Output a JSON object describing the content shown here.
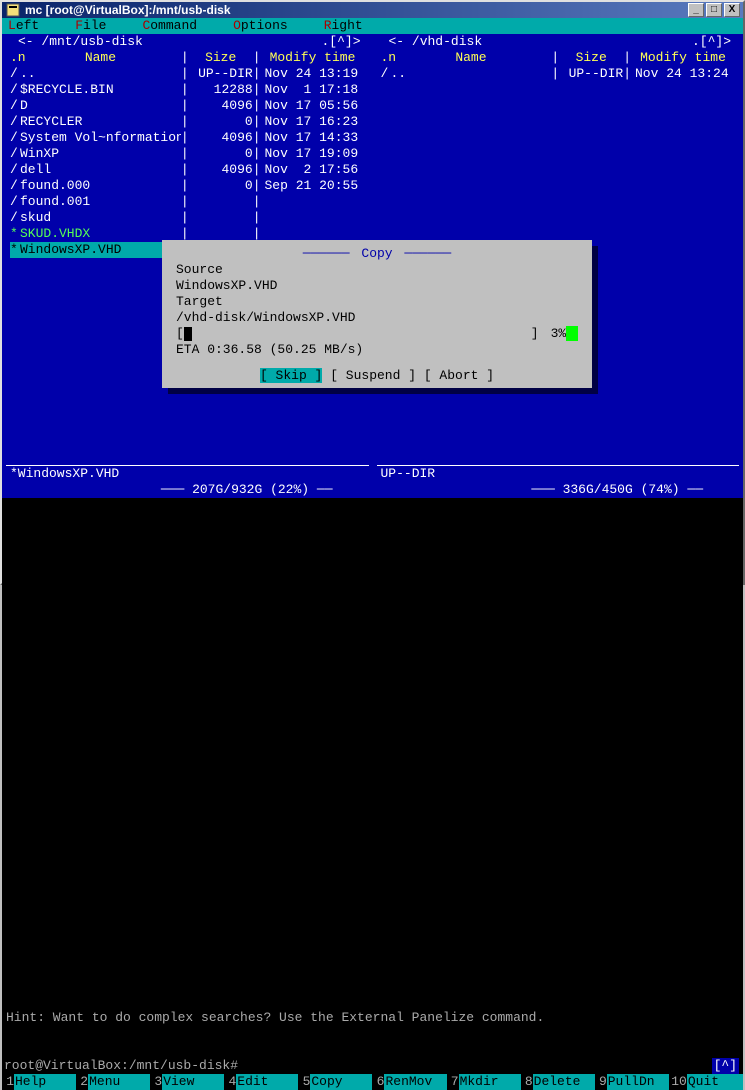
{
  "window": {
    "title": "mc [root@VirtualBox]:/mnt/usb-disk"
  },
  "menubar": {
    "left": "Left",
    "file": "File",
    "command": "Command",
    "options": "Options",
    "right": "Right"
  },
  "left_panel": {
    "path": "/mnt/usb-disk",
    "selector": ".[^]>",
    "headers": {
      "n": ".n",
      "name": "Name",
      "size": "Size",
      "mtime": "Modify time"
    },
    "rows": [
      {
        "n": "/",
        "name": "..",
        "size": "UP--DIR",
        "mtime": "Nov 24 13:19",
        "green": false
      },
      {
        "n": "/",
        "name": "$RECYCLE.BIN",
        "size": "12288",
        "mtime": "Nov  1 17:18",
        "green": false
      },
      {
        "n": "/",
        "name": "D",
        "size": "4096",
        "mtime": "Nov 17 05:56",
        "green": false
      },
      {
        "n": "/",
        "name": "RECYCLER",
        "size": "0",
        "mtime": "Nov 17 16:23",
        "green": false
      },
      {
        "n": "/",
        "name": "System Vol~nformation",
        "size": "4096",
        "mtime": "Nov 17 14:33",
        "green": false
      },
      {
        "n": "/",
        "name": "WinXP",
        "size": "0",
        "mtime": "Nov 17 19:09",
        "green": false
      },
      {
        "n": "/",
        "name": "dell",
        "size": "4096",
        "mtime": "Nov  2 17:56",
        "green": false
      },
      {
        "n": "/",
        "name": "found.000",
        "size": "0",
        "mtime": "Sep 21 20:55",
        "green": false
      },
      {
        "n": "/",
        "name": "found.001",
        "size": "",
        "mtime": "",
        "green": false
      },
      {
        "n": "/",
        "name": "skud",
        "size": "",
        "mtime": "",
        "green": false
      },
      {
        "n": "*",
        "name": "SKUD.VHDX",
        "size": "",
        "mtime": "",
        "green": true
      },
      {
        "n": "*",
        "name": "WindowsXP.VHD",
        "size": "",
        "mtime": "",
        "selected": true,
        "green": true
      }
    ],
    "footer_name": "*WindowsXP.VHD",
    "disk": "207G/932G (22%)"
  },
  "right_panel": {
    "path": "/vhd-disk",
    "selector": ".[^]>",
    "headers": {
      "n": ".n",
      "name": "Name",
      "size": "Size",
      "mtime": "Modify time"
    },
    "rows": [
      {
        "n": "/",
        "name": "..",
        "size": "UP--DIR",
        "mtime": "Nov 24 13:24"
      }
    ],
    "footer_name": "UP--DIR",
    "disk": "336G/450G (74%)"
  },
  "dialog": {
    "title": "Copy",
    "source_label": "Source",
    "source": "WindowsXP.VHD",
    "target_label": "Target",
    "target": "/vhd-disk/WindowsXP.VHD",
    "percent": "3%",
    "eta": "ETA 0:36.58 (50.25 MB/s)",
    "skip": "[ Skip ]",
    "suspend": "[ Suspend ]",
    "abort": "[ Abort ]"
  },
  "hint": "Hint: Want to do complex searches? Use the External Panelize command.",
  "prompt": "root@VirtualBox:/mnt/usb-disk#",
  "prompt_up": "[^]",
  "fnkeys": [
    {
      "n": "1",
      "label": "Help"
    },
    {
      "n": "2",
      "label": "Menu"
    },
    {
      "n": "3",
      "label": "View"
    },
    {
      "n": "4",
      "label": "Edit"
    },
    {
      "n": "5",
      "label": "Copy"
    },
    {
      "n": "6",
      "label": "RenMov"
    },
    {
      "n": "7",
      "label": "Mkdir"
    },
    {
      "n": "8",
      "label": "Delete"
    },
    {
      "n": "9",
      "label": "PullDn"
    },
    {
      "n": "10",
      "label": "Quit"
    }
  ]
}
